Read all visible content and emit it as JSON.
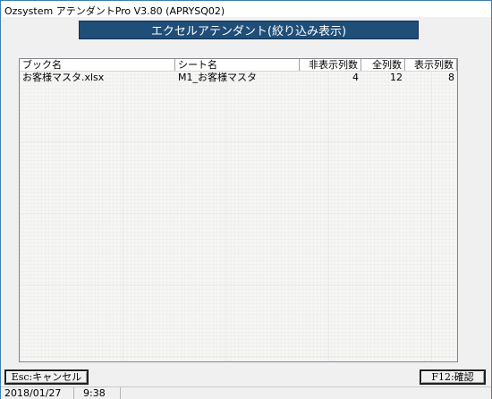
{
  "window": {
    "title": "Ozsystem アテンダントPro V3.80 (APRYSQ02)"
  },
  "banner": {
    "text": "エクセルアテンダント(絞り込み表示)"
  },
  "table": {
    "columns": [
      "ブック名",
      "シート名",
      "非表示列数",
      "全列数",
      "表示列数"
    ],
    "rows": [
      {
        "book": "お客様マスタ.xlsx",
        "sheet": "M1_お客様マスタ",
        "hidden": "4",
        "total": "12",
        "shown": "8"
      }
    ]
  },
  "buttons": {
    "esc_label": "Esc:キャンセル",
    "f12_label": "F12:確認"
  },
  "status": {
    "date": "2018/01/27",
    "time": "9:38"
  },
  "colors": {
    "banner_bg": "#1f4e79",
    "window_border": "#3c7fb1"
  }
}
